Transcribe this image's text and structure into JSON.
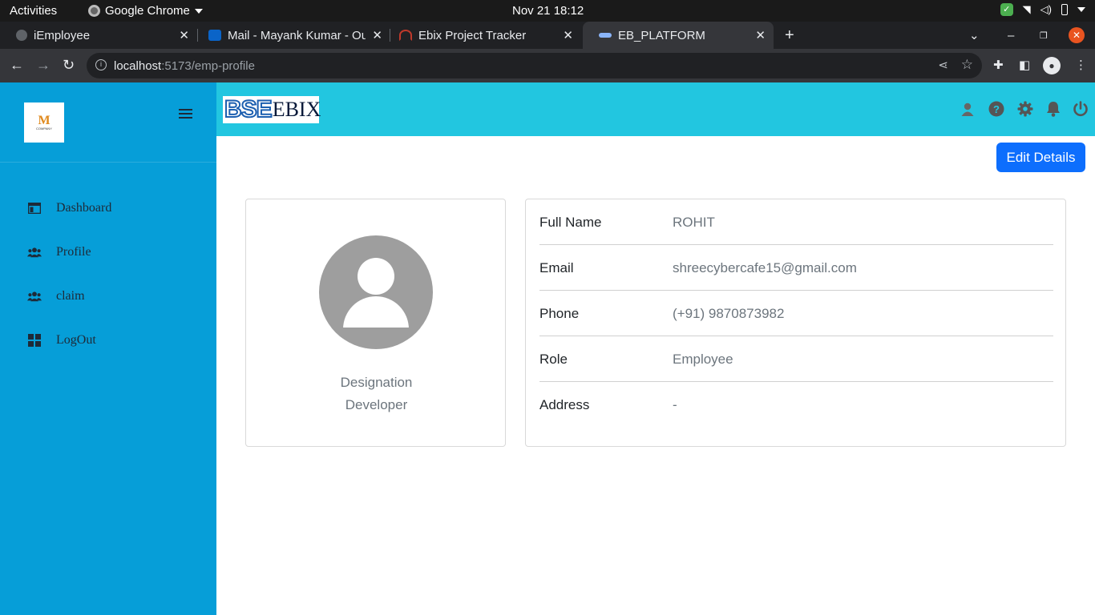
{
  "desktop": {
    "activities": "Activities",
    "app_name": "Google Chrome",
    "clock": "Nov 21  18:12"
  },
  "browser": {
    "tabs": [
      {
        "title": "iEmployee",
        "active": false
      },
      {
        "title": "Mail - Mayank Kumar - Ou",
        "active": false
      },
      {
        "title": "Ebix Project Tracker",
        "active": false
      },
      {
        "title": "EB_PLATFORM",
        "active": true
      }
    ],
    "new_tab": "+",
    "url_host": "localhost",
    "url_path": ":5173/emp-profile"
  },
  "sidebar": {
    "logo_text": "M",
    "logo_sub": "COMPANY",
    "items": [
      {
        "label": "Dashboard",
        "icon": "dashboard-icon"
      },
      {
        "label": "Profile",
        "icon": "users-icon"
      },
      {
        "label": "claim",
        "icon": "users-icon"
      },
      {
        "label": "LogOut",
        "icon": "grid-icon"
      }
    ]
  },
  "header": {
    "brand_a": "BSE",
    "brand_b": "EBIX",
    "icons": [
      "user-icon",
      "help-icon",
      "gear-icon",
      "bell-icon",
      "power-icon"
    ]
  },
  "profile": {
    "edit_label": "Edit Details",
    "designation_label": "Designation",
    "designation_value": "Developer",
    "fields": [
      {
        "key": "Full Name",
        "value": "ROHIT"
      },
      {
        "key": "Email",
        "value": "shreecybercafe15@gmail.com"
      },
      {
        "key": "Phone",
        "value": "(+91) 9870873982"
      },
      {
        "key": "Role",
        "value": "Employee"
      },
      {
        "key": "Address",
        "value": "-"
      }
    ]
  },
  "colors": {
    "sidebar_bg": "#069ed8",
    "header_bg": "#22c6e0",
    "primary_button": "#0d6efd"
  }
}
